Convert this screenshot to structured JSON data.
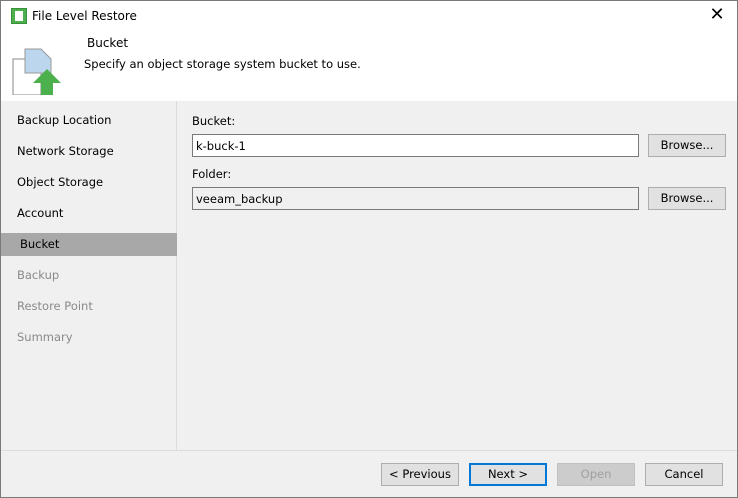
{
  "window": {
    "title": "File Level Restore",
    "close_glyph": "✕"
  },
  "header": {
    "title": "Bucket",
    "description": "Specify an object storage system bucket to use."
  },
  "nav": {
    "items": [
      {
        "label": "Backup Location",
        "state": "done"
      },
      {
        "label": "Network Storage",
        "state": "done"
      },
      {
        "label": "Object Storage",
        "state": "done"
      },
      {
        "label": "Account",
        "state": "done"
      },
      {
        "label": "Bucket",
        "state": "active"
      },
      {
        "label": "Backup",
        "state": "disabled"
      },
      {
        "label": "Restore Point",
        "state": "disabled"
      },
      {
        "label": "Summary",
        "state": "disabled"
      }
    ]
  },
  "form": {
    "bucket_label": "Bucket:",
    "bucket_value": "k-buck-1",
    "folder_label": "Folder:",
    "folder_value": "veeam_backup",
    "browse_label": "Browse..."
  },
  "footer": {
    "previous": "< Previous",
    "next": "Next >",
    "open": "Open",
    "cancel": "Cancel"
  }
}
